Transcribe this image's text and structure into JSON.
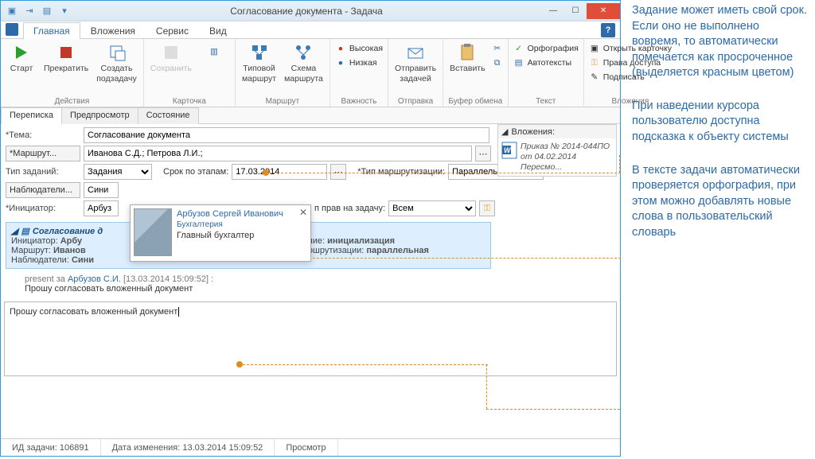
{
  "window": {
    "title": "Согласование документа - Задача"
  },
  "tabs": {
    "main": "Главная",
    "attachments": "Вложения",
    "service": "Сервис",
    "view": "Вид"
  },
  "ribbon": {
    "actions": {
      "start": "Старт",
      "stop": "Прекратить",
      "subtask": "Создать\nподзадачу",
      "group": "Действия"
    },
    "card": {
      "save": "Сохранить",
      "group": "Карточка"
    },
    "route": {
      "typical": "Типовой\nмаршрут",
      "scheme": "Схема\nмаршрута",
      "group": "Маршрут"
    },
    "importance": {
      "high": "Высокая",
      "low": "Низкая",
      "group": "Важность"
    },
    "send": {
      "send": "Отправить\nзадачей",
      "paste": "Вставить",
      "group": "Отправка"
    },
    "clipboard": {
      "group": "Буфер обмена"
    },
    "text": {
      "spell": "Орфография",
      "auto": "Автотексты",
      "group": "Текст"
    },
    "attach_g": {
      "open": "Открыть карточку",
      "rights": "Права доступа",
      "sign": "Подписать",
      "group": "Вложения"
    }
  },
  "subtabs": {
    "correspondence": "Переписка",
    "preview": "Предпросмотр",
    "state": "Состояние"
  },
  "form": {
    "theme_label": "*Тема:",
    "theme": "Согласование документа",
    "route_btn": "*Маршрут...",
    "route": "Иванова С.Д.; Петрова Л.И.;",
    "tasktype_label": "Тип заданий:",
    "tasktype": "Задания",
    "stepdate_label": "Срок по этапам:",
    "stepdate": "17.03.2014",
    "routetype_label": "*Тип маршрутизации:",
    "routetype": "Параллельная",
    "watchers_btn": "Наблюдатели...",
    "watchers": "Сини",
    "initiator_label": "*Инициатор:",
    "initiator": "Арбуз",
    "rights_label": "п прав на задачу:",
    "rights": "Всем"
  },
  "card": {
    "title": "Согласование д",
    "l1a": "Инициатор:",
    "l1b": "Арбу",
    "r1a": "остояние:",
    "r1b": "инициализация",
    "l2a": "Маршрут:",
    "l2b": "Иванов",
    "r2a": "ип маршрутизации:",
    "r2b": "параллельная",
    "l3a": "Наблюдатели:",
    "l3b": "Сини"
  },
  "msg": {
    "prefix": "present за ",
    "author": "Арбузов С.И.",
    "date": "[13.03.2014 15:09:52] :",
    "body": "Прошу согласовать вложенный документ"
  },
  "editor": "Прошу согласовать вложенный документ",
  "status": {
    "id_label": "ИД задачи:",
    "id": "106891",
    "mod_label": "Дата изменения:",
    "mod": "13.03.2014 15:09:52",
    "mode": "Просмотр"
  },
  "att": {
    "header": "Вложения:",
    "item1": "Приказ № 2014-044ПО",
    "item2": "от 04.02.2014 Пересмо..."
  },
  "tooltip": {
    "name": "Арбузов Сергей Иванович",
    "dept": "Бухгалтерия",
    "role": "Главный бухгалтер"
  },
  "annotations": {
    "a1": "Задание может иметь свой срок. Если оно не выполнено вовремя, то автоматически поме­чается как просроченное (выделяется красным цветом)",
    "a2": "При наведении курсора пользователю доступна подсказка к объекту системы",
    "a3": "В тексте задачи авто­матически проверяется орфография, при этом можно добавлять новые слова в пользователь­ский словарь"
  }
}
